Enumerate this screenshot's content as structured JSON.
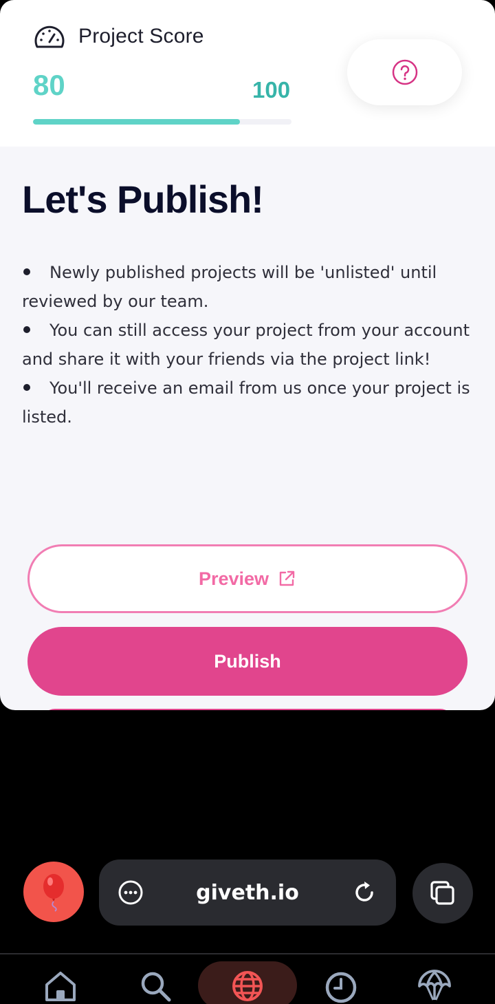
{
  "score": {
    "title": "Project Score",
    "value": "80",
    "max": "100",
    "progress": 0.8,
    "accent_color": "#5fd3c7",
    "help_icon": "question-icon",
    "gauge_icon": "gauge-icon"
  },
  "content": {
    "heading": "Let's Publish!",
    "bullets": [
      "Newly published projects will be 'unlisted' until reviewed by our team.",
      "You can still access your project from your account and share it with your friends via the project link!",
      "You'll receive an email from us once your project is listed."
    ],
    "preview_label": "Preview",
    "publish_label": "Publish",
    "brand_color": "#e1458d"
  },
  "browser": {
    "url": "giveth.io"
  },
  "nav": {
    "items": [
      "home-icon",
      "search-icon",
      "globe-icon",
      "history-icon",
      "airdrop-icon"
    ],
    "active": "globe-icon"
  }
}
